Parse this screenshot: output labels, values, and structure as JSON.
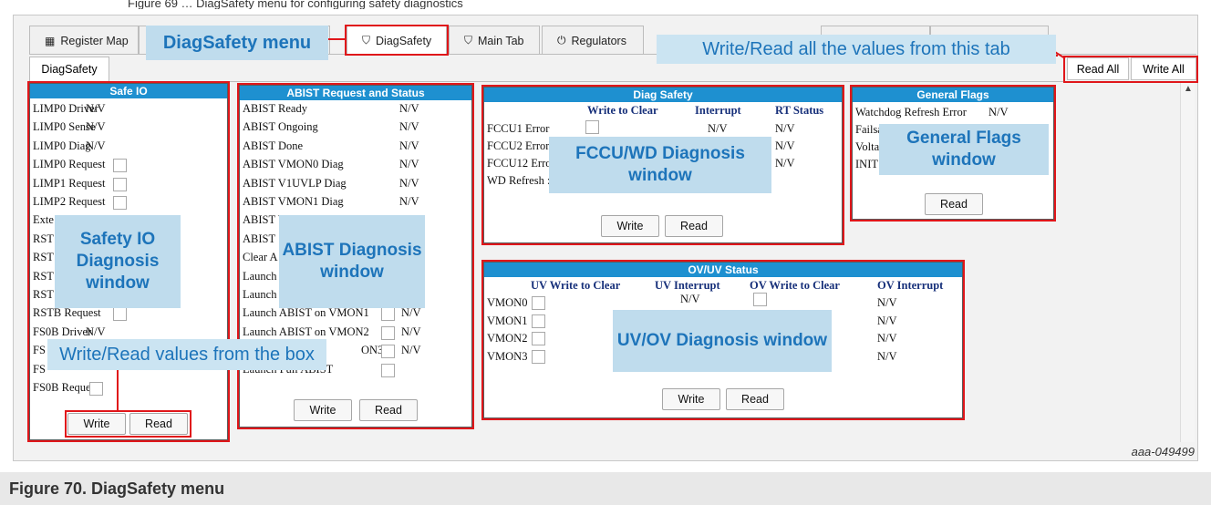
{
  "top_text": "Figure 69 … DiagSafety menu for configuring safety diagnostics",
  "tabs": [
    {
      "label": "Register Map",
      "icon": "grid-icon"
    },
    {
      "label": "DiagSafety",
      "icon": "shield-icon"
    },
    {
      "label": "Main Tab",
      "icon": "shield-icon"
    },
    {
      "label": "Regulators",
      "icon": "power-icon"
    }
  ],
  "subtab": "DiagSafety",
  "top_buttons": {
    "read_all": "Read All",
    "write_all": "Write All"
  },
  "safe_io": {
    "title": "Safe IO",
    "rows": [
      {
        "label": "LIMP0 Driver",
        "value": "N/V"
      },
      {
        "label": "LIMP0 Sense",
        "value": "N/V"
      },
      {
        "label": "LIMP0 Diag",
        "value": "N/V"
      },
      {
        "label": "LIMP0 Request",
        "value": ""
      },
      {
        "label": "LIMP1 Request",
        "value": ""
      },
      {
        "label": "LIMP2 Request",
        "value": ""
      },
      {
        "label": "Exte",
        "value": "N/V"
      },
      {
        "label": "RST",
        "value": ""
      },
      {
        "label": "RST",
        "value": ""
      },
      {
        "label": "RST",
        "value": ""
      },
      {
        "label": "RST",
        "value": ""
      },
      {
        "label": "RSTB Request",
        "value": ""
      },
      {
        "label": "FS0B Driver",
        "value": "N/V"
      },
      {
        "label": "FS",
        "value": ""
      },
      {
        "label": "FS",
        "value": ""
      },
      {
        "label": "FS0B Request",
        "value": ""
      }
    ],
    "write": "Write",
    "read": "Read"
  },
  "abist": {
    "title": "ABIST Request and Status",
    "rows": [
      {
        "label": "ABIST Ready",
        "value": "N/V"
      },
      {
        "label": "ABIST Ongoing",
        "value": "N/V"
      },
      {
        "label": "ABIST Done",
        "value": "N/V"
      },
      {
        "label": "ABIST VMON0 Diag",
        "value": "N/V"
      },
      {
        "label": "ABIST V1UVLP Diag",
        "value": "N/V"
      },
      {
        "label": "ABIST VMON1 Diag",
        "value": "N/V"
      },
      {
        "label": "ABIST VMON2 Diag",
        "value": "N/V"
      },
      {
        "label": "ABIST",
        "value": ""
      },
      {
        "label": "Clear A",
        "value": ""
      },
      {
        "label": "Launch",
        "value": ""
      },
      {
        "label": "Launch",
        "value": ""
      },
      {
        "label": "Launch ABIST on VMON1",
        "value": "N/V"
      },
      {
        "label": "Launch ABIST on VMON2",
        "value": "N/V"
      },
      {
        "label": "ON3",
        "value": "N/V"
      },
      {
        "label": "Launch Full ABIST",
        "value": ""
      }
    ],
    "write": "Write",
    "read": "Read"
  },
  "diag_safety": {
    "title": "Diag Safety",
    "col_headers": [
      "Write to Clear",
      "Interrupt",
      "RT Status"
    ],
    "rows": [
      {
        "label": "FCCU1 Error",
        "interrupt": "N/V",
        "rt": "N/V"
      },
      {
        "label": "FCCU2 Error",
        "interrupt": "",
        "rt": "N/V"
      },
      {
        "label": "FCCU12 Erro",
        "interrupt": "",
        "rt": "N/V"
      },
      {
        "label": "WD Refresh :",
        "interrupt": "",
        "rt": ""
      }
    ],
    "write": "Write",
    "read": "Read"
  },
  "general_flags": {
    "title": "General Flags",
    "rows": [
      {
        "label": "Watchdog Refresh Error",
        "value": "N/V"
      },
      {
        "label": "Failsa",
        "value": ""
      },
      {
        "label": "Volta",
        "value": ""
      },
      {
        "label": "INIT",
        "value": ""
      }
    ],
    "read": "Read"
  },
  "ovuv": {
    "title": "OV/UV Status",
    "col_headers": [
      "UV Write to Clear",
      "UV Interrupt",
      "OV Write to Clear",
      "OV Interrupt"
    ],
    "rows": [
      {
        "label": "VMON0",
        "uv_int": "N/V",
        "ov_int": "N/V"
      },
      {
        "label": "VMON1",
        "uv_int": "",
        "ov_int": "N/V"
      },
      {
        "label": "VMON2",
        "uv_int": "",
        "ov_int": "N/V"
      },
      {
        "label": "VMON3",
        "uv_int": "",
        "ov_int": "N/V"
      }
    ],
    "write": "Write",
    "read": "Read"
  },
  "callouts": {
    "diagsafety_menu": "DiagSafety menu",
    "write_read_all": "Write/Read all the values from this tab",
    "safety_io": "Safety IO Diagnosis window",
    "abist": "ABIST Diagnosis window",
    "fccu": "FCCU/WD Diagnosis window",
    "general_flags": "General Flags window",
    "uvov": "UV/OV Diagnosis window",
    "write_read_box": "Write/Read values from the box"
  },
  "figure_id": "aaa-049499",
  "caption": "Figure 70.  DiagSafety menu",
  "colors": {
    "panel_header": "#1e90d0",
    "callout_text": "#1d74ba",
    "highlight": "#e0161a",
    "column_header": "#17307a"
  }
}
